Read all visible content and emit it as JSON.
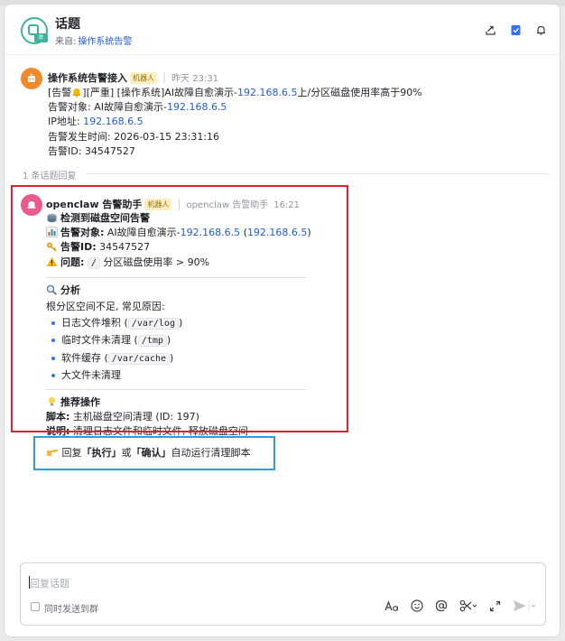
{
  "header": {
    "title": "话题",
    "source_label": "来自:",
    "source_link": "操作系统告警",
    "icon_tag": "群"
  },
  "first_message": {
    "sender": "操作系统告警接入",
    "badge": "机器人",
    "time": "昨天 23:31",
    "line1": {
      "prefix": "[告警",
      "suffix": "][严重] [操作系统]AI故障自愈演示-",
      "ip": "192.168.6.5",
      "tail": "上/分区磁盘使用率高于90%"
    },
    "line2": {
      "label": "告警对象: AI故障自愈演示-",
      "ip": "192.168.6.5"
    },
    "line3": {
      "label": "IP地址: ",
      "ip": "192.168.6.5"
    },
    "line4": "告警发生时间: 2026-03-15 23:31:16",
    "line5": "告警ID: 34547527"
  },
  "reply_count": "1 条话题回复",
  "reply": {
    "sender": "openclaw 告警助手",
    "badge": "机器人",
    "meta": "openclaw 告警助手",
    "time": "16:21",
    "heading": "检测到磁盘空间告警",
    "target": {
      "label": "告警对象:",
      "text": " AI故障自愈演示-",
      "ip1": "192.168.6.5",
      "ip2": "192.168.6.5"
    },
    "alert_id": {
      "label": "告警ID:",
      "value": " 34547527"
    },
    "problem": {
      "label": "问题:",
      "code": "/",
      "text": " 分区磁盘使用率 > 90%"
    },
    "analysis_title": "分析",
    "analysis_intro": "根分区空间不足, 常见原因:",
    "causes": [
      {
        "text": "日志文件堆积 (",
        "code": "/var/log",
        "end": ")"
      },
      {
        "text": "临时文件未清理 (",
        "code": "/tmp",
        "end": ")"
      },
      {
        "text": "软件缓存 (",
        "code": "/var/cache",
        "end": ")"
      },
      {
        "text": "大文件未清理",
        "code": "",
        "end": ""
      }
    ],
    "recommend_title": "推荐操作",
    "script": {
      "label": "脚本:",
      "value": " 主机磁盘空间清理 (ID: 197)"
    },
    "note": {
      "label": "说明:",
      "value": " 清理日志文件和临时文件, 释放磁盘空间"
    },
    "cta": {
      "pre": " 回复",
      "k1": "「执行」",
      "mid": "或",
      "k2": "「确认」",
      "post": "自动运行清理脚本"
    }
  },
  "composer": {
    "placeholder": "回复话题",
    "also_send_label": "同时发送到群"
  },
  "icons": {
    "topic": "topic-icon",
    "share": "share-icon",
    "bookmark": "bookmark-icon",
    "bell": "bell-icon",
    "robot": "robot-icon",
    "format": "text-format-icon",
    "emoji": "emoji-icon",
    "mention": "mention-icon",
    "scissors": "scissors-icon",
    "expand": "expand-icon",
    "send": "send-icon"
  },
  "colors": {
    "link": "#245bdb",
    "bot_badge_bg": "#fbefc2",
    "highlight_red": "#d9232e",
    "highlight_blue": "#2a9ee0"
  }
}
